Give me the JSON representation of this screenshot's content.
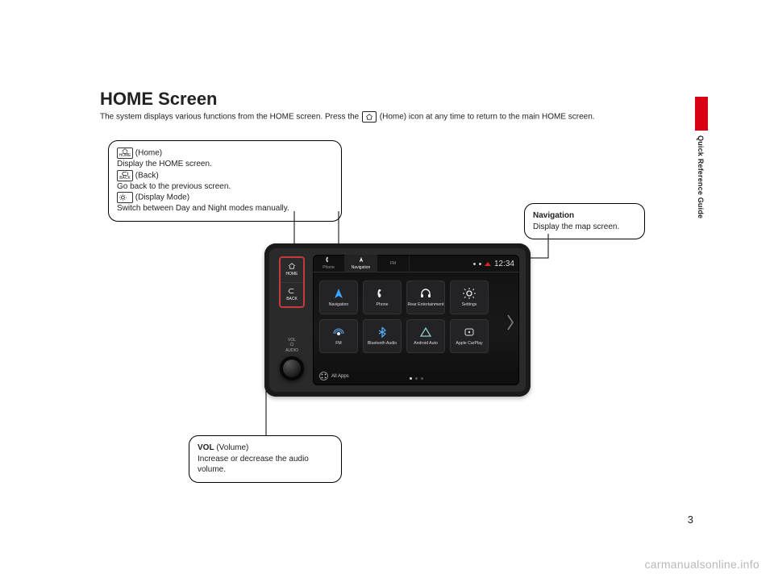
{
  "header": {
    "title": "HOME Screen",
    "subtitle_pre": "The system displays various functions from the HOME screen. Press the ",
    "subtitle_post": " (Home) icon at any time to return to the main HOME screen."
  },
  "side_label": "Quick Reference Guide",
  "page_number": "3",
  "watermark": "carmanualsonline.info",
  "callouts": {
    "buttons": {
      "home_label": " (Home)",
      "home_desc": "Display the HOME screen.",
      "back_label": " (Back)",
      "back_desc": "Go back to the previous screen.",
      "disp_label": " (Display Mode)",
      "disp_desc": "Switch between Day and Night modes manually."
    },
    "nav": {
      "title": "Navigation",
      "desc": "Display the map screen."
    },
    "vol": {
      "title": "VOL",
      "title_extra": " (Volume)",
      "desc": "Increase or decrease the audio volume."
    }
  },
  "unit": {
    "hw": {
      "home": "HOME",
      "back": "BACK",
      "vol_top": "VOL",
      "vol_bot": "AUDIO"
    },
    "tabs": [
      "Phone",
      "Navigation",
      "FM"
    ],
    "clock": "12:34",
    "apps": [
      "Navigation",
      "Phone",
      "Rear Entertainment",
      "Settings",
      "FM",
      "Bluetooth Audio",
      "Android Auto",
      "Apple CarPlay"
    ],
    "all_apps": "All Apps"
  },
  "icons": {
    "home": "home-icon",
    "back": "back-icon",
    "display_mode": "display-mode-icon"
  }
}
